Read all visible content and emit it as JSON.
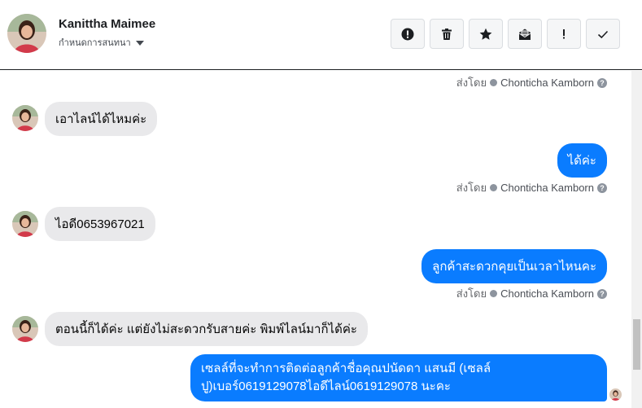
{
  "header": {
    "contact_name": "Kanittha Maimee",
    "assign_label": "กำหนดการสนทนา",
    "tools": [
      {
        "icon": "spam-icon",
        "label": "!"
      },
      {
        "icon": "trash-icon",
        "label": ""
      },
      {
        "icon": "star-icon",
        "label": ""
      },
      {
        "icon": "mark-unread-icon",
        "label": ""
      },
      {
        "icon": "follow-up-icon",
        "label": "!"
      },
      {
        "icon": "done-icon",
        "label": ""
      }
    ]
  },
  "thread": {
    "sent_by_prefix": "ส่งโดย",
    "sent_by_name": "Chonticha Kamborn",
    "help_glyph": "?",
    "messages": [
      {
        "dir": "in",
        "text": "เอาไลน์ได้ไหมค่ะ"
      },
      {
        "dir": "out",
        "text": "ได้ค่ะ"
      },
      {
        "dir": "in",
        "text": "ไอดี0653967021"
      },
      {
        "dir": "out",
        "text": "ลูกค้าสะดวกคุยเป็นเวลาไหนคะ"
      },
      {
        "dir": "in",
        "text": "ตอนนี้ก็ได้ค่ะ แต่ยังไม่สะดวกรับสายค่ะ พิมพ์ไลน์มาก็ได้ค่ะ"
      },
      {
        "dir": "out",
        "text": "เซลล์ที่จะทำการติดต่อลูกค้าชื่อคุณปนัดดา แสนมี (เซลล์ ปู)เบอร์0619129078ไอดีไลน์0619129078 นะคะ"
      }
    ]
  },
  "colors": {
    "outgoing_bubble": "#0a7cff",
    "incoming_bubble": "#e9e9eb",
    "meta_text": "#65676b"
  }
}
